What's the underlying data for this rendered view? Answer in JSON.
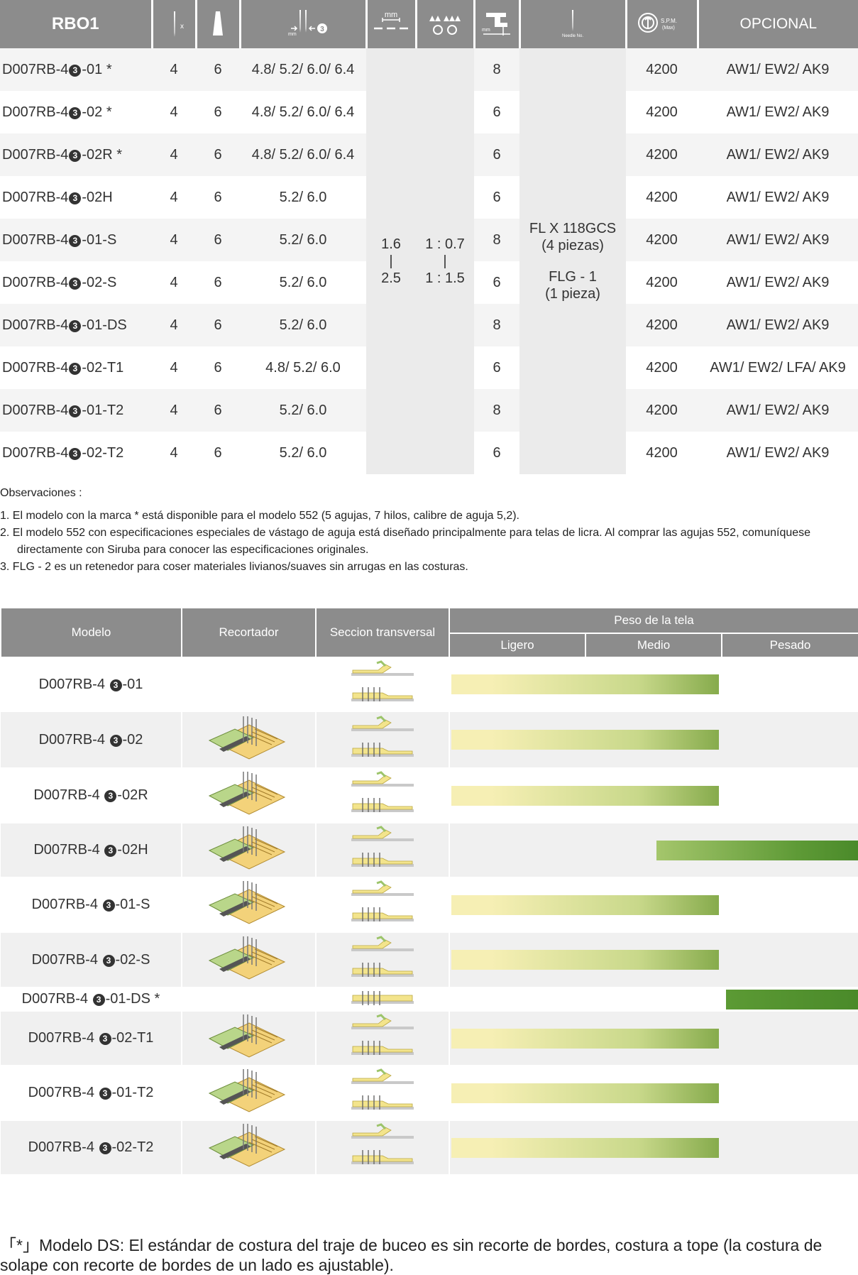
{
  "spec_table": {
    "header": {
      "model_col": "RBO1",
      "x_label": "x",
      "optional": "OPCIONAL",
      "spm_label": "S.P.M.",
      "spm_max": "(Max)",
      "needle_label": "Needle No.",
      "mm1": "mm",
      "mm2": "mm",
      "mm3": "mm"
    },
    "rows": [
      {
        "pre": "D007RB-4",
        "mark": "3",
        "post": "-01 *",
        "needles": "4",
        "threads": "6",
        "gauge": "4.8/ 5.2/ 6.0/ 6.4",
        "feed": "8",
        "spm": "4200",
        "optional": "AW1/ EW2/ AK9"
      },
      {
        "pre": "D007RB-4",
        "mark": "3",
        "post": "-02 *",
        "needles": "4",
        "threads": "6",
        "gauge": "4.8/ 5.2/ 6.0/ 6.4",
        "feed": "6",
        "spm": "4200",
        "optional": "AW1/ EW2/ AK9"
      },
      {
        "pre": "D007RB-4",
        "mark": "3",
        "post": "-02R *",
        "needles": "4",
        "threads": "6",
        "gauge": "4.8/ 5.2/ 6.0/ 6.4",
        "feed": "6",
        "spm": "4200",
        "optional": "AW1/ EW2/ AK9"
      },
      {
        "pre": "D007RB-4",
        "mark": "3",
        "post": "-02H",
        "needles": "4",
        "threads": "6",
        "gauge": "5.2/ 6.0",
        "feed": "6",
        "spm": "4200",
        "optional": "AW1/ EW2/ AK9"
      },
      {
        "pre": "D007RB-4",
        "mark": "3",
        "post": "-01-S",
        "needles": "4",
        "threads": "6",
        "gauge": "5.2/ 6.0",
        "feed": "8",
        "spm": "4200",
        "optional": "AW1/ EW2/ AK9"
      },
      {
        "pre": "D007RB-4",
        "mark": "3",
        "post": "-02-S",
        "needles": "4",
        "threads": "6",
        "gauge": "5.2/ 6.0",
        "feed": "6",
        "spm": "4200",
        "optional": "AW1/ EW2/ AK9"
      },
      {
        "pre": "D007RB-4",
        "mark": "3",
        "post": "-01-DS",
        "needles": "4",
        "threads": "6",
        "gauge": "5.2/ 6.0",
        "feed": "8",
        "spm": "4200",
        "optional": "AW1/ EW2/ AK9"
      },
      {
        "pre": "D007RB-4",
        "mark": "3",
        "post": "-02-T1",
        "needles": "4",
        "threads": "6",
        "gauge": "4.8/ 5.2/ 6.0",
        "feed": "6",
        "spm": "4200",
        "optional": "AW1/ EW2/ LFA/ AK9"
      },
      {
        "pre": "D007RB-4",
        "mark": "3",
        "post": "-01-T2",
        "needles": "4",
        "threads": "6",
        "gauge": "5.2/ 6.0",
        "feed": "8",
        "spm": "4200",
        "optional": "AW1/ EW2/ AK9"
      },
      {
        "pre": "D007RB-4",
        "mark": "3",
        "post": "-02-T2",
        "needles": "4",
        "threads": "6",
        "gauge": "5.2/ 6.0",
        "feed": "6",
        "spm": "4200",
        "optional": "AW1/ EW2/ AK9"
      }
    ],
    "stitch_length": {
      "top": "1.6",
      "sep": "|",
      "bottom": "2.5"
    },
    "diff_ratio": {
      "top": "1 : 0.7",
      "sep": "|",
      "bottom": "1 : 1.5"
    },
    "needle": {
      "line1": "FL X 118GCS",
      "line2": "(4 piezas)",
      "line3": "FLG - 1",
      "line4": "(1 pieza)"
    }
  },
  "notes": {
    "title": "Observaciones :",
    "items": [
      "1.  El modelo con la marca * está disponible para el modelo 552 (5 agujas, 7 hilos, calibre de aguja 5,2).",
      "2.  El modelo 552 con especificaciones especiales de vástago de aguja está diseñado principalmente para telas de licra. Al comprar las agujas 552, comuníquese directamente con Siruba para conocer las especificaciones originales.",
      "3.  FLG - 2 es un retenedor para coser materiales livianos/suaves sin arrugas en las costuras."
    ]
  },
  "fabric_table": {
    "headers": {
      "model": "Modelo",
      "trimmer": "Recortador",
      "section": "Seccion transversal",
      "weight": "Peso de la tela",
      "light": "Ligero",
      "medium": "Medio",
      "heavy": "Pesado"
    },
    "colors": {
      "light_end": "#f6efb4",
      "mid": "#c8d88a",
      "dark_end": "#4a8a2a",
      "yellow": "#f3e48c",
      "green_plate": "#b9d68a"
    },
    "rows": [
      {
        "pre": "D007RB-4 ",
        "mark": "3",
        "post": "-01",
        "trimmer": false,
        "weight_from": 0,
        "weight_to": 0.66
      },
      {
        "pre": "D007RB-4 ",
        "mark": "3",
        "post": "-02",
        "trimmer": true,
        "weight_from": 0,
        "weight_to": 0.66
      },
      {
        "pre": "D007RB-4 ",
        "mark": "3",
        "post": "-02R",
        "trimmer": true,
        "weight_from": 0,
        "weight_to": 0.66
      },
      {
        "pre": "D007RB-4 ",
        "mark": "3",
        "post": "-02H",
        "trimmer": true,
        "weight_from": 0.5,
        "weight_to": 1.0
      },
      {
        "pre": "D007RB-4 ",
        "mark": "3",
        "post": "-01-S",
        "trimmer": true,
        "weight_from": 0,
        "weight_to": 0.66
      },
      {
        "pre": "D007RB-4 ",
        "mark": "3",
        "post": "-02-S",
        "trimmer": true,
        "weight_from": 0,
        "weight_to": 0.66
      },
      {
        "pre": "D007RB-4 ",
        "mark": "3",
        "post": "-01-DS *",
        "trimmer": false,
        "weight_from": 0.67,
        "weight_to": 1.0
      },
      {
        "pre": "D007RB-4 ",
        "mark": "3",
        "post": "-02-T1",
        "trimmer": true,
        "weight_from": 0,
        "weight_to": 0.66
      },
      {
        "pre": "D007RB-4 ",
        "mark": "3",
        "post": "-01-T2",
        "trimmer": true,
        "weight_from": 0,
        "weight_to": 0.66
      },
      {
        "pre": "D007RB-4 ",
        "mark": "3",
        "post": "-02-T2",
        "trimmer": true,
        "weight_from": 0,
        "weight_to": 0.66
      }
    ]
  },
  "footer": "「*」Modelo DS: El estándar de costura del traje de buceo es sin recorte de bordes, costura a tope (la costura de solape con recorte de bordes de un lado es ajustable)."
}
